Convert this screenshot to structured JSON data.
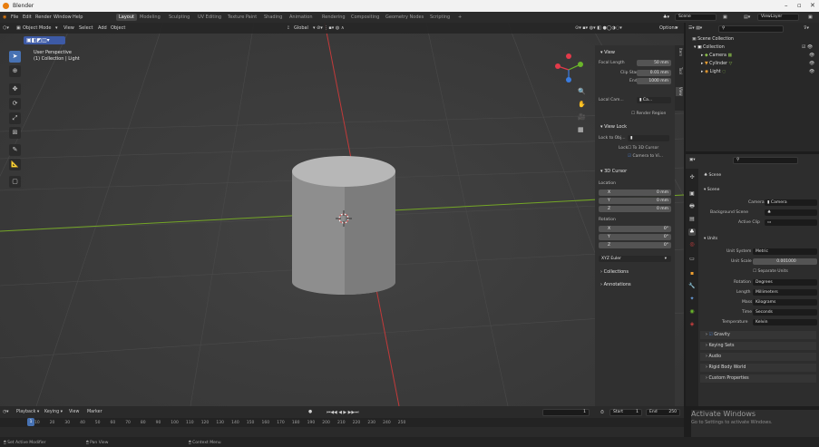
{
  "window": {
    "title": "Blender"
  },
  "menu": {
    "items": [
      "File",
      "Edit",
      "Render",
      "Window",
      "Help"
    ],
    "workspaces": [
      "Layout",
      "Modeling",
      "Sculpting",
      "UV Editing",
      "Texture Paint",
      "Shading",
      "Animation",
      "Rendering",
      "Compositing",
      "Geometry Nodes",
      "Scripting",
      "+"
    ],
    "active_workspace": "Layout",
    "scene": "Scene",
    "view_layer": "ViewLayer"
  },
  "viewport_header": {
    "mode": "Object Mode",
    "menus": [
      "View",
      "Select",
      "Add",
      "Object"
    ],
    "orientation": "Global",
    "options": "Options"
  },
  "viewport": {
    "perspective": "User Perspective",
    "collection_info": "(1) Collection | Light"
  },
  "npanel": {
    "tabs": [
      "Item",
      "Tool",
      "View"
    ],
    "view_header": "View",
    "focal_length_label": "Focal Length",
    "focal_length": "50 mm",
    "clip_start_label": "Clip Start",
    "clip_start": "0.01 mm",
    "clip_end_label": "End",
    "clip_end": "1000 mm",
    "local_camera_label": "Local Cam...",
    "local_camera_value": "Ca...",
    "render_region": "Render Region",
    "view_lock_header": "View Lock",
    "lock_to_object_label": "Lock to Obj...",
    "lock_label": "Lock",
    "to_3d_cursor": "To 3D Cursor",
    "camera_to_view": "Camera to Vi...",
    "cursor_header": "3D Cursor",
    "location_label": "Location",
    "rotation_label": "Rotation",
    "loc": [
      {
        "axis": "X",
        "value": "0 mm"
      },
      {
        "axis": "Y",
        "value": "0 mm"
      },
      {
        "axis": "Z",
        "value": "0 mm"
      }
    ],
    "rot": [
      {
        "axis": "X",
        "value": "0°"
      },
      {
        "axis": "Y",
        "value": "0°"
      },
      {
        "axis": "Z",
        "value": "0°"
      }
    ],
    "rotation_mode": "XYZ Euler",
    "collections": "Collections",
    "annotations": "Annotations"
  },
  "outliner": {
    "root": "Scene Collection",
    "collection": "Collection",
    "items": [
      "Camera",
      "Cylinder",
      "Light"
    ]
  },
  "properties": {
    "scene_name": "Scene",
    "scene_section": "Scene",
    "camera_label": "Camera",
    "camera_value": "Camera",
    "background_scene_label": "Background Scene",
    "active_clip_label": "Active Clip",
    "units_section": "Units",
    "unit_system_label": "Unit System",
    "unit_system": "Metric",
    "unit_scale_label": "Unit Scale",
    "unit_scale": "0.001000",
    "separate_units": "Separate Units",
    "rotation_label": "Rotation",
    "rotation": "Degrees",
    "length_label": "Length",
    "length": "Millimeters",
    "mass_label": "Mass",
    "mass": "Kilograms",
    "time_label": "Time",
    "time": "Seconds",
    "temperature_label": "Temperature",
    "temperature": "Kelvin",
    "gravity": "Gravity",
    "sections": [
      "Keying Sets",
      "Audio",
      "Rigid Body World",
      "Custom Properties"
    ]
  },
  "timeline": {
    "menus": [
      "Playback",
      "Keying",
      "View",
      "Marker"
    ],
    "current_frame": "1",
    "start_label": "Start",
    "start": "1",
    "end_label": "End",
    "end": "250",
    "ticks": [
      "1",
      "10",
      "20",
      "30",
      "40",
      "50",
      "60",
      "70",
      "80",
      "90",
      "100",
      "110",
      "120",
      "130",
      "140",
      "150",
      "160",
      "170",
      "180",
      "190",
      "200",
      "210",
      "220",
      "230",
      "240",
      "250"
    ]
  },
  "statusbar": {
    "items": [
      "Set Active Modifier",
      "Pan View",
      "Context Menu"
    ]
  },
  "activate": {
    "title": "Activate Windows",
    "subtitle": "Go to Settings to activate Windows."
  },
  "colors": {
    "accent": "#4772b3",
    "x_axis": "#c23a3a",
    "y_axis": "#74a626",
    "gizmo_x": "#e33a4a",
    "gizmo_y": "#6ab52a",
    "gizmo_z": "#3a7ce0"
  }
}
